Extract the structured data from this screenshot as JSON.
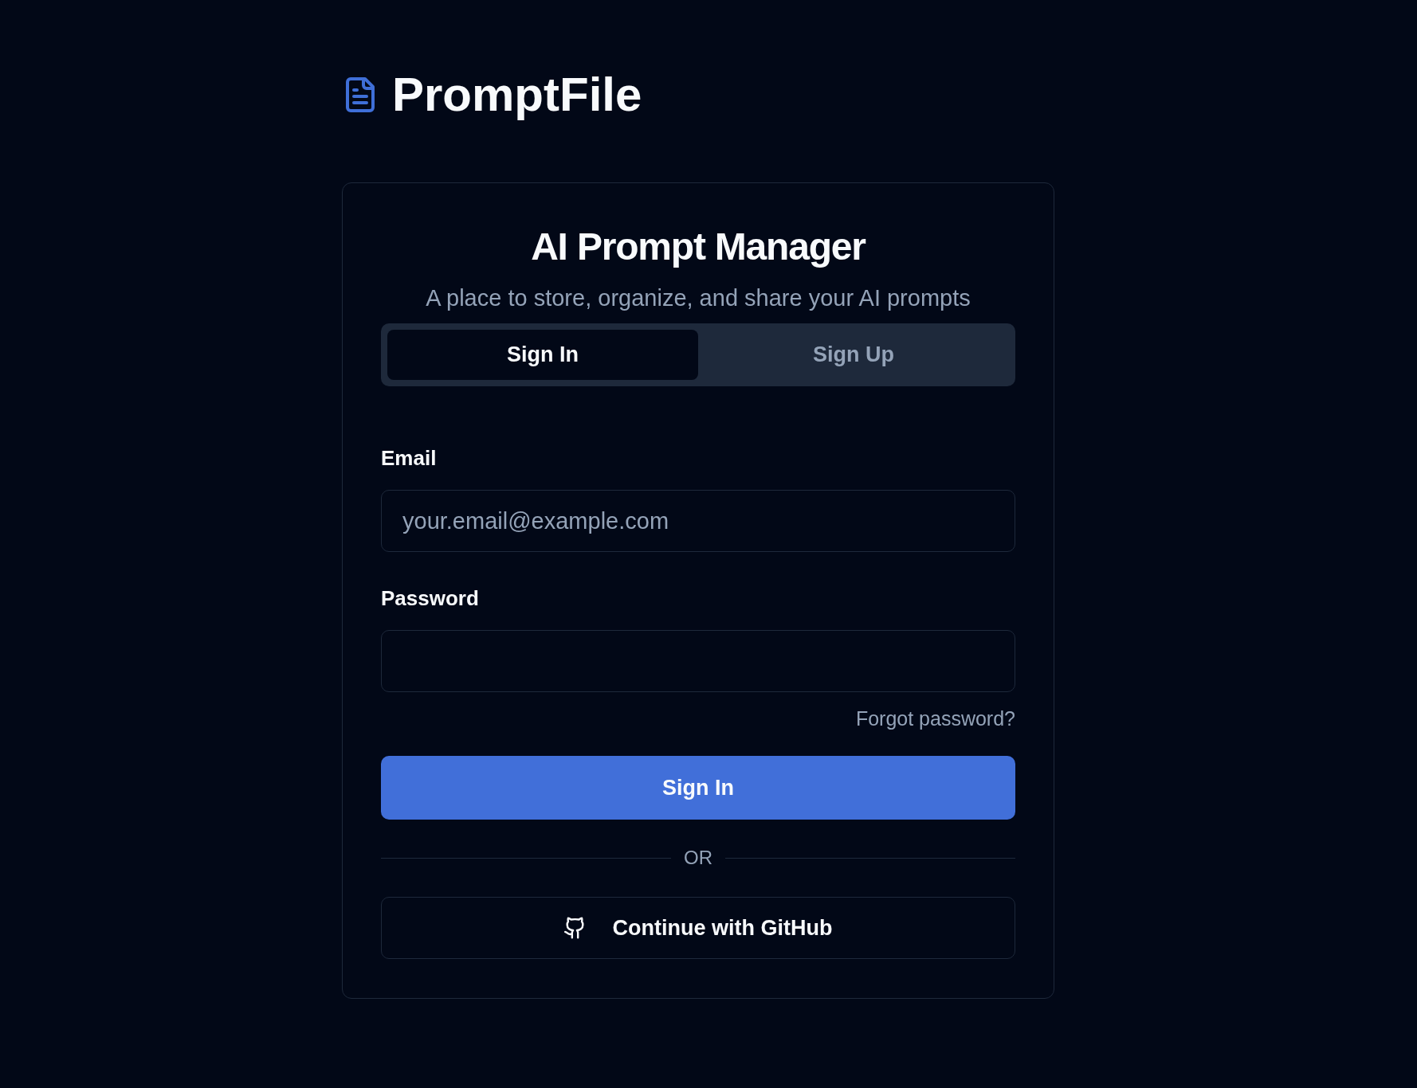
{
  "header": {
    "title": "PromptFile"
  },
  "card": {
    "title": "AI Prompt Manager",
    "subtitle": "A place to store, organize, and share your AI prompts",
    "tabs": [
      {
        "label": "Sign In",
        "selected": true
      },
      {
        "label": "Sign Up",
        "selected": false
      }
    ],
    "fields": [
      {
        "label": "Email",
        "placeholder": "your.email@example.com"
      },
      {
        "label": "Password"
      }
    ],
    "forgot_link": "Forgot password?",
    "submit_button": "Sign In",
    "divider": "OR",
    "github_button": "Continue with GitHub"
  }
}
